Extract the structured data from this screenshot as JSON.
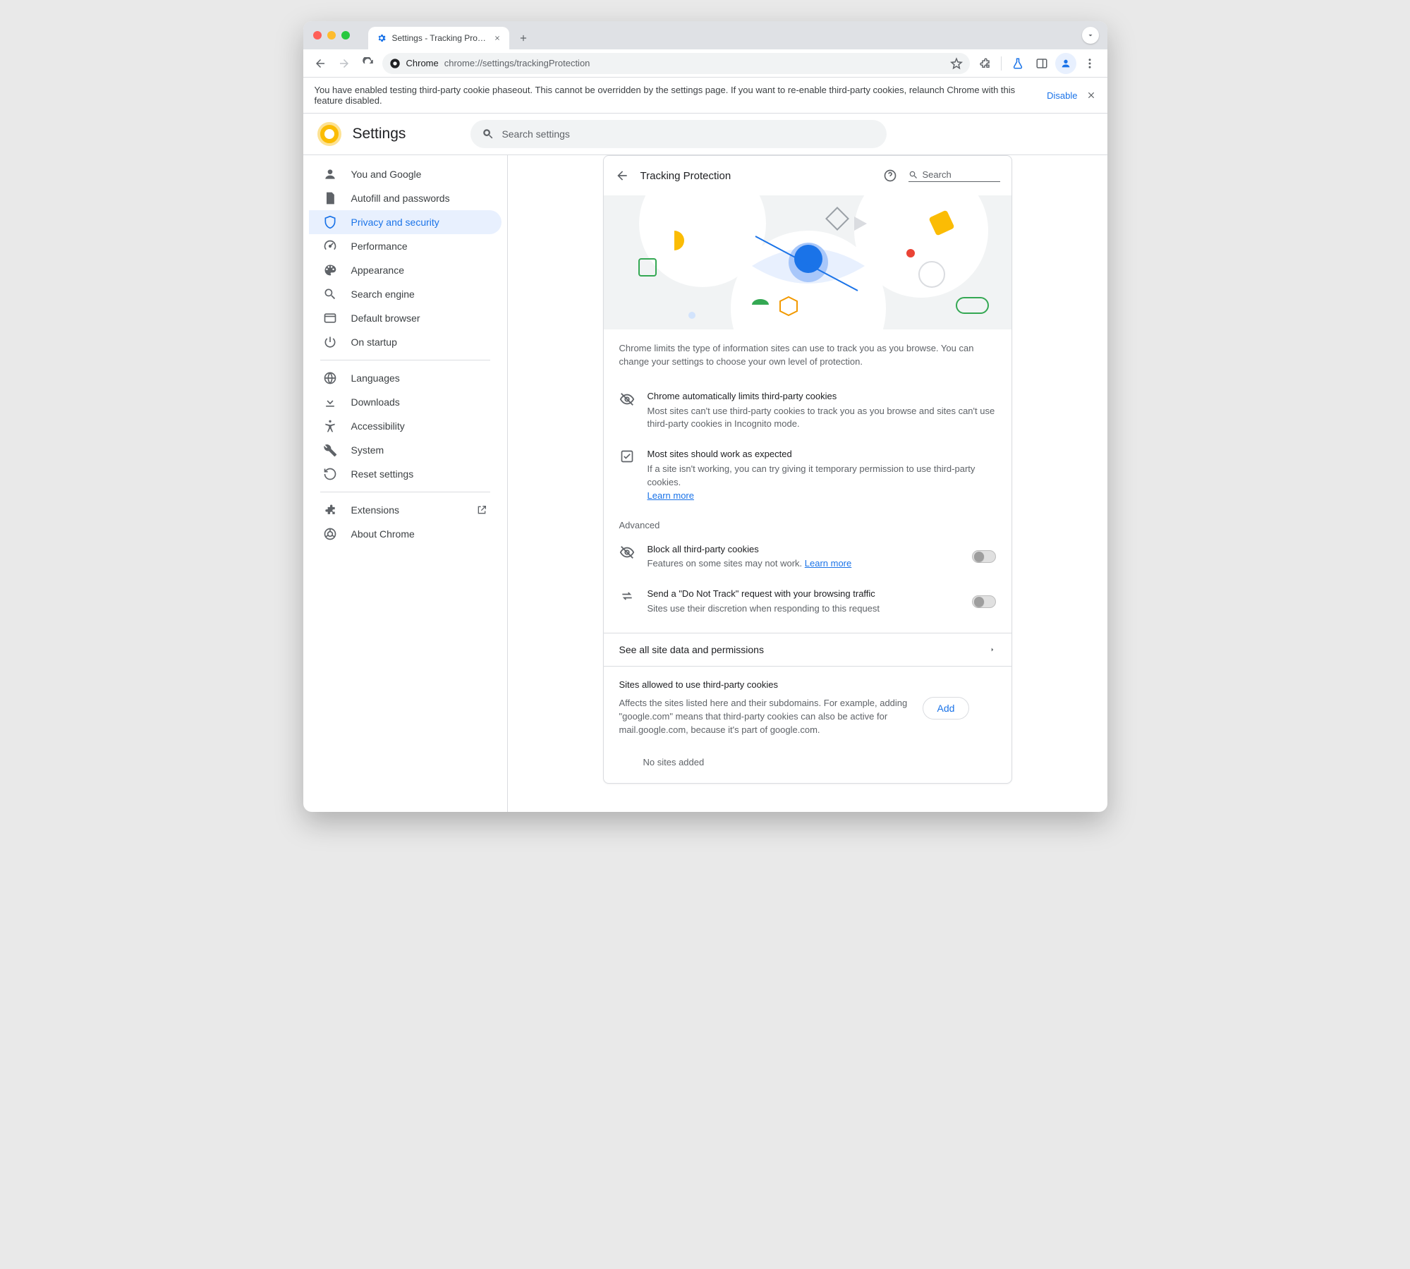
{
  "browser": {
    "tab_title": "Settings - Tracking Protectio",
    "chrome_label": "Chrome",
    "url": "chrome://settings/trackingProtection"
  },
  "notice": {
    "text": "You have enabled testing third-party cookie phaseout. This cannot be overridden by the settings page. If you want to re-enable third-party cookies, relaunch Chrome with this feature disabled.",
    "disable_label": "Disable"
  },
  "settings": {
    "title": "Settings",
    "search_placeholder": "Search settings"
  },
  "nav": {
    "items": [
      {
        "label": "You and Google"
      },
      {
        "label": "Autofill and passwords"
      },
      {
        "label": "Privacy and security"
      },
      {
        "label": "Performance"
      },
      {
        "label": "Appearance"
      },
      {
        "label": "Search engine"
      },
      {
        "label": "Default browser"
      },
      {
        "label": "On startup"
      },
      {
        "label": "Languages"
      },
      {
        "label": "Downloads"
      },
      {
        "label": "Accessibility"
      },
      {
        "label": "System"
      },
      {
        "label": "Reset settings"
      },
      {
        "label": "Extensions"
      },
      {
        "label": "About Chrome"
      }
    ]
  },
  "page": {
    "title": "Tracking Protection",
    "search_placeholder": "Search",
    "intro": "Chrome limits the type of information sites can use to track you as you browse. You can change your settings to choose your own level of protection.",
    "auto": {
      "title": "Chrome automatically limits third-party cookies",
      "body": "Most sites can't use third-party cookies to track you as you browse and sites can't use third-party cookies in Incognito mode."
    },
    "expect": {
      "title": "Most sites should work as expected",
      "body": "If a site isn't working, you can try giving it temporary permission to use third-party cookies.",
      "learn": "Learn more"
    },
    "advanced_label": "Advanced",
    "block": {
      "title": "Block all third-party cookies",
      "body": "Features on some sites may not work. ",
      "learn": "Learn more"
    },
    "dnt": {
      "title": "Send a \"Do Not Track\" request with your browsing traffic",
      "body": "Sites use their discretion when responding to this request"
    },
    "see_all": "See all site data and permissions",
    "sites": {
      "title": "Sites allowed to use third-party cookies",
      "body": "Affects the sites listed here and their subdomains. For example, adding \"google.com\" means that third-party cookies can also be active for mail.google.com, because it's part of google.com.",
      "add": "Add",
      "empty": "No sites added"
    }
  }
}
